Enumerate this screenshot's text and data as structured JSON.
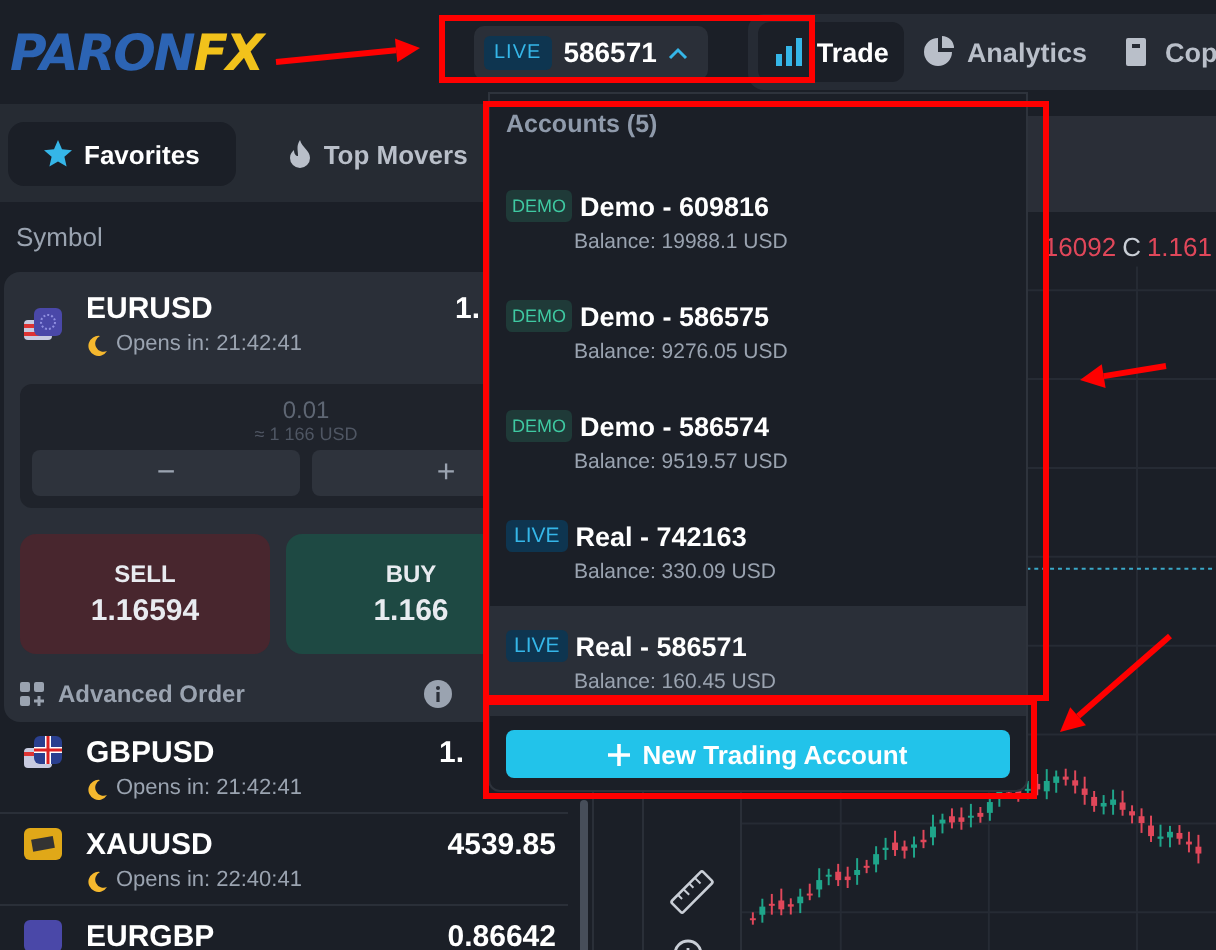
{
  "logo": {
    "text_1": "PARON",
    "text_2": "FX"
  },
  "account_switcher": {
    "badge": "LIVE",
    "number": "586571",
    "expanded": true
  },
  "nav_tabs": [
    {
      "label": "Trade",
      "selected": true
    },
    {
      "label": "Analytics",
      "selected": false
    },
    {
      "label": "Cop",
      "selected": false
    }
  ],
  "panel_tabs": [
    {
      "label": "Favorites",
      "selected": true
    },
    {
      "label": "Top Movers",
      "selected": false
    }
  ],
  "symbol_header": "Symbol",
  "active_symbol": {
    "name": "EURUSD",
    "opens_in": "Opens in: 21:42:41",
    "price": "1.",
    "volume": "0.01",
    "approx": "≈ 1 166 USD",
    "minus": "−",
    "plus": "+",
    "sell_label": "SELL",
    "sell_price": "1.16594",
    "buy_label": "BUY",
    "buy_price": "1.166",
    "advanced_order": "Advanced Order"
  },
  "symbol_list": [
    {
      "name": "GBPUSD",
      "opens_in": "Opens in: 21:42:41",
      "price": "1."
    },
    {
      "name": "XAUUSD",
      "opens_in": "Opens in: 22:40:41",
      "price": "4539.85"
    },
    {
      "name": "EURGBP",
      "price": "0.86642"
    }
  ],
  "chart": {
    "low_value": "16092",
    "close_label": "C",
    "close_value": "1.161"
  },
  "accounts_menu": {
    "title": "Accounts (5)",
    "new_button": "New Trading Account",
    "accounts": [
      {
        "kind": "demo",
        "badge": "DEMO",
        "name": "Demo - 609816",
        "balance": "Balance: 19988.1 USD",
        "selected": false
      },
      {
        "kind": "demo",
        "badge": "DEMO",
        "name": "Demo - 586575",
        "balance": "Balance: 9276.05 USD",
        "selected": false
      },
      {
        "kind": "demo",
        "badge": "DEMO",
        "name": "Demo - 586574",
        "balance": "Balance: 9519.57 USD",
        "selected": false
      },
      {
        "kind": "live",
        "badge": "LIVE",
        "name": "Real - 742163",
        "balance": "Balance: 330.09 USD",
        "selected": false
      },
      {
        "kind": "live",
        "badge": "LIVE",
        "name": "Real - 586571",
        "balance": "Balance: 160.45 USD",
        "selected": true
      }
    ]
  }
}
